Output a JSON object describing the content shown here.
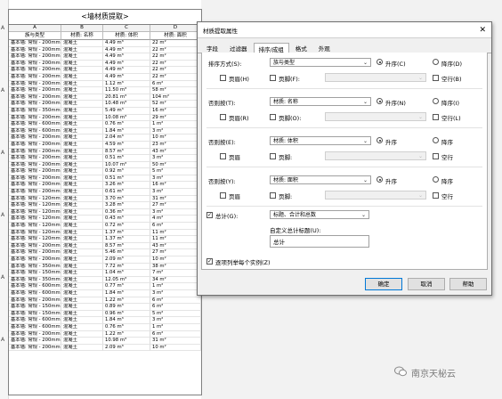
{
  "schedule": {
    "title": "<墙材质提取>",
    "letters": [
      "A",
      "B",
      "C",
      "D"
    ],
    "headers": [
      "族与类型",
      "材质: 名称",
      "材质: 体积",
      "材质: 面积"
    ],
    "rows": [
      [
        "基本墙: 常规 - 200mm",
        "混凝土",
        "4.49 m³",
        "22 m²"
      ],
      [
        "基本墙: 常规 - 200mm",
        "混凝土",
        "4.49 m³",
        "22 m²"
      ],
      [
        "基本墙: 常规 - 200mm",
        "混凝土",
        "4.49 m³",
        "22 m²"
      ],
      [
        "基本墙: 常规 - 200mm",
        "混凝土",
        "4.49 m³",
        "22 m²"
      ],
      [
        "基本墙: 常规 - 200mm",
        "混凝土",
        "4.49 m³",
        "22 m²"
      ],
      [
        "基本墙: 常规 - 200mm",
        "混凝土",
        "4.49 m³",
        "22 m²"
      ],
      [
        "基本墙: 常规 - 200mm",
        "混凝土",
        "1.12 m³",
        "6 m²"
      ],
      [
        "基本墙: 常规 - 200mm",
        "混凝土",
        "11.50 m³",
        "58 m²"
      ],
      [
        "基本墙: 常规 - 200mm",
        "混凝土",
        "20.81 m³",
        "104 m²"
      ],
      [
        "基本墙: 常规 - 200mm",
        "混凝土",
        "10.48 m³",
        "52 m²"
      ],
      [
        "基本墙: 常规 - 350mm",
        "混凝土",
        "5.49 m³",
        "16 m²"
      ],
      [
        "基本墙: 常规 - 200mm",
        "混凝土",
        "10.08 m³",
        "29 m²"
      ],
      [
        "基本墙: 常规 - 600mm",
        "混凝土",
        "0.76 m³",
        "1 m²"
      ],
      [
        "基本墙: 常规 - 600mm",
        "混凝土",
        "1.84 m³",
        "3 m²"
      ],
      [
        "基本墙: 常规 - 200mm",
        "混凝土",
        "2.04 m³",
        "10 m²"
      ],
      [
        "基本墙: 常规 - 200mm",
        "混凝土",
        "4.59 m³",
        "23 m²"
      ],
      [
        "基本墙: 常规 - 200mm",
        "混凝土",
        "8.57 m³",
        "43 m²"
      ],
      [
        "基本墙: 常规 - 200mm",
        "混凝土",
        "0.51 m³",
        "3 m²"
      ],
      [
        "基本墙: 常规 - 200mm",
        "混凝土",
        "10.07 m³",
        "50 m²"
      ],
      [
        "基本墙: 常规 - 200mm",
        "混凝土",
        "0.92 m³",
        "5 m²"
      ],
      [
        "基本墙: 常规 - 200mm",
        "混凝土",
        "0.51 m³",
        "3 m²"
      ],
      [
        "基本墙: 常规 - 200mm",
        "混凝土",
        "3.26 m³",
        "16 m²"
      ],
      [
        "基本墙: 常规 - 200mm",
        "混凝土",
        "0.61 m³",
        "3 m²"
      ],
      [
        "基本墙: 常规 - 120mm",
        "混凝土",
        "3.70 m³",
        "31 m²"
      ],
      [
        "基本墙: 常规 - 120mm",
        "混凝土",
        "3.28 m³",
        "27 m²"
      ],
      [
        "基本墙: 常规 - 120mm",
        "混凝土",
        "0.36 m³",
        "3 m²"
      ],
      [
        "基本墙: 常规 - 120mm",
        "混凝土",
        "0.43 m³",
        "4 m²"
      ],
      [
        "基本墙: 常规 - 120mm",
        "混凝土",
        "0.72 m³",
        "6 m²"
      ],
      [
        "基本墙: 常规 - 120mm",
        "混凝土",
        "1.37 m³",
        "11 m²"
      ],
      [
        "基本墙: 常规 - 120mm",
        "混凝土",
        "1.37 m³",
        "11 m²"
      ],
      [
        "基本墙: 常规 - 200mm",
        "混凝土",
        "8.57 m³",
        "43 m²"
      ],
      [
        "基本墙: 常规 - 200mm",
        "混凝土",
        "5.46 m³",
        "27 m²"
      ],
      [
        "基本墙: 常规 - 200mm",
        "混凝土",
        "2.09 m³",
        "10 m²"
      ],
      [
        "基本墙: 常规 - 350mm",
        "混凝土",
        "7.72 m³",
        "38 m²"
      ],
      [
        "基本墙: 常规 - 150mm",
        "混凝土",
        "1.04 m³",
        "7 m²"
      ],
      [
        "基本墙: 常规 - 350mm",
        "混凝土",
        "12.05 m³",
        "34 m²"
      ],
      [
        "基本墙: 常规 - 600mm",
        "混凝土",
        "0.77 m³",
        "1 m²"
      ],
      [
        "基本墙: 常规 - 600mm",
        "混凝土",
        "1.84 m³",
        "3 m²"
      ],
      [
        "基本墙: 常规 - 200mm",
        "混凝土",
        "1.22 m³",
        "6 m²"
      ],
      [
        "基本墙: 常规 - 150mm",
        "混凝土",
        "0.89 m³",
        "6 m²"
      ],
      [
        "基本墙: 常规 - 150mm",
        "混凝土",
        "0.96 m³",
        "5 m²"
      ],
      [
        "基本墙: 常规 - 600mm",
        "混凝土",
        "1.84 m³",
        "3 m²"
      ],
      [
        "基本墙: 常规 - 600mm",
        "混凝土",
        "0.76 m³",
        "1 m²"
      ],
      [
        "基本墙: 常规 - 200mm",
        "混凝土",
        "1.22 m³",
        "6 m²"
      ],
      [
        "基本墙: 常规 - 200mm",
        "混凝土",
        "10.98 m³",
        "31 m²"
      ],
      [
        "基本墙: 常规 - 200mm",
        "混凝土",
        "2.09 m³",
        "10 m²"
      ]
    ]
  },
  "dialog": {
    "title": "材质提取属性",
    "close_glyph": "✕",
    "tabs": [
      "字段",
      "过滤器",
      "排序/成组",
      "格式",
      "外观"
    ],
    "sorts": [
      {
        "label": "排序方式(S):",
        "value": "族与类型",
        "asc": "升序(C)",
        "desc": "降序(D)",
        "header": "页眉(H)",
        "footer": "页脚(F):",
        "blank": "空行(B)",
        "enabled": true
      },
      {
        "label": "否则按(T):",
        "value": "材质: 名称",
        "asc": "升序(N)",
        "desc": "降序(I)",
        "header": "页眉(R)",
        "footer": "页脚(O):",
        "blank": "空行(L)",
        "enabled": true
      },
      {
        "label": "否则按(E):",
        "value": "材质: 体积",
        "asc": "升序",
        "desc": "降序",
        "header": "页眉",
        "footer": "页脚:",
        "blank": "空行",
        "enabled": true
      },
      {
        "label": "否则按(Y):",
        "value": "材质: 面积",
        "asc": "升序",
        "desc": "降序",
        "header": "页眉",
        "footer": "页脚:",
        "blank": "空行",
        "enabled": true
      }
    ],
    "total_label": "总计(G):",
    "total_value": "标题、合计和总数",
    "custom_total_label": "自定义总计标题(U):",
    "custom_total_value": "总计",
    "itemize_label": "逐项列举每个实例(Z)",
    "ok": "确定",
    "cancel": "取消",
    "help": "帮助"
  },
  "watermark": {
    "text": "南京天柲云"
  },
  "left_marks": [
    "A",
    "A",
    "A",
    "A",
    "A",
    "A"
  ]
}
